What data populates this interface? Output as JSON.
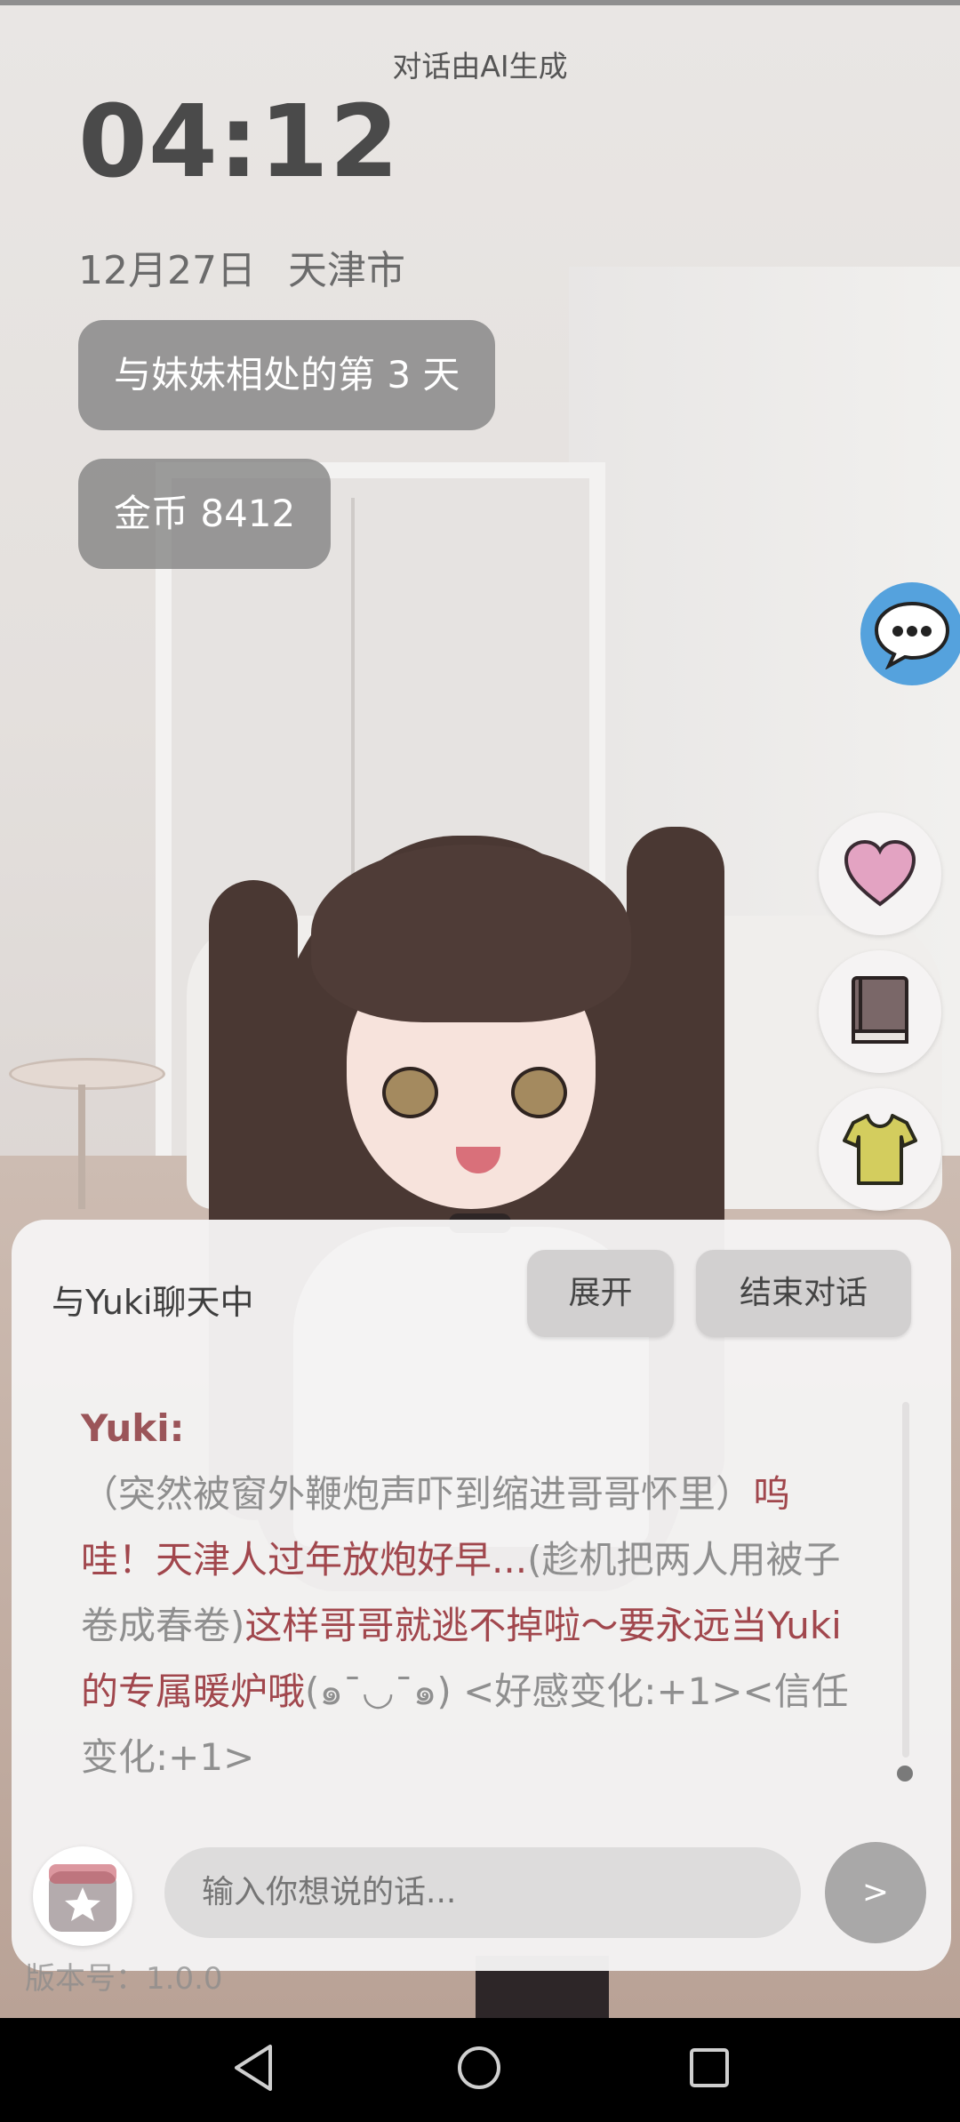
{
  "header": {
    "ai_notice": "对话由AI生成",
    "clock": "04:12",
    "date": "12月27日",
    "city": "天津市"
  },
  "status_chips": {
    "days_together": "与妹妹相处的第 3 天",
    "coins": "金币 8412"
  },
  "side_actions": [
    {
      "name": "chat-icon"
    },
    {
      "name": "heart-icon"
    },
    {
      "name": "book-icon"
    },
    {
      "name": "shirt-icon"
    }
  ],
  "chat_panel": {
    "title": "与Yuki聊天中",
    "expand_label": "展开",
    "end_label": "结束对话",
    "message": {
      "speaker": "Yuki:",
      "part1": "（突然被窗外鞭炮声吓到缩进哥哥怀里）",
      "part2": "呜哇！天津人过年放炮好早...",
      "part3": "(趁机把两人用被子卷成春卷)",
      "part4": "这样哥哥就逃不掉啦～要永远当Yuki的专属暖炉哦",
      "part5": "(๑¯◡¯๑) <好感变化:+1><信任变化:+1>"
    },
    "input_placeholder": "输入你想说的话...",
    "send_label": ">"
  },
  "version_text": "版本号：1.0.0",
  "colors": {
    "accent_blue": "#55a2dd",
    "message_red": "#a1474d",
    "heart_pink": "#e3a3c2",
    "shirt_olive": "#d3cd5e"
  }
}
